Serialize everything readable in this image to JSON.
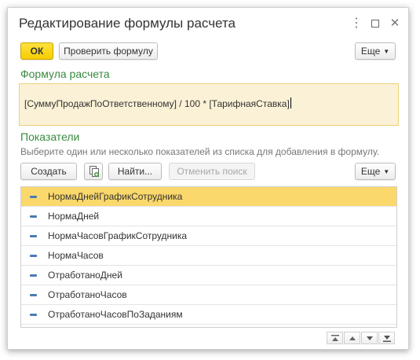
{
  "window": {
    "title": "Редактирование формулы расчета",
    "controls": {
      "more": "⋮",
      "maximize": "",
      "close": "✕"
    }
  },
  "toolbar": {
    "ok_label": "ОК",
    "check_label": "Проверить формулу",
    "more_label": "Еще"
  },
  "formula": {
    "section_title": "Формула расчета",
    "text": "[СуммуПродажПоОтветственному]  / 100 *  [ТарифнаяСтавка]"
  },
  "indicators": {
    "section_title": "Показатели",
    "hint": "Выберите один или несколько показателей из списка для добавления в формулу.",
    "create_label": "Создать",
    "find_label": "Найти...",
    "cancel_search_label": "Отменить поиск",
    "more_label": "Еще",
    "items": [
      {
        "label": "НормаДнейГрафикСотрудника",
        "selected": true
      },
      {
        "label": "НормаДней",
        "selected": false
      },
      {
        "label": "НормаЧасовГрафикСотрудника",
        "selected": false
      },
      {
        "label": "НормаЧасов",
        "selected": false
      },
      {
        "label": "ОтработаноДней",
        "selected": false
      },
      {
        "label": "ОтработаноЧасов",
        "selected": false
      },
      {
        "label": "ОтработаноЧасовПоЗаданиям",
        "selected": false
      }
    ]
  },
  "colors": {
    "accent_green": "#3a8a3f",
    "ok_yellow": "#f5cd00",
    "selected_row": "#fbd86b",
    "formula_bg": "#fbf1d6"
  }
}
